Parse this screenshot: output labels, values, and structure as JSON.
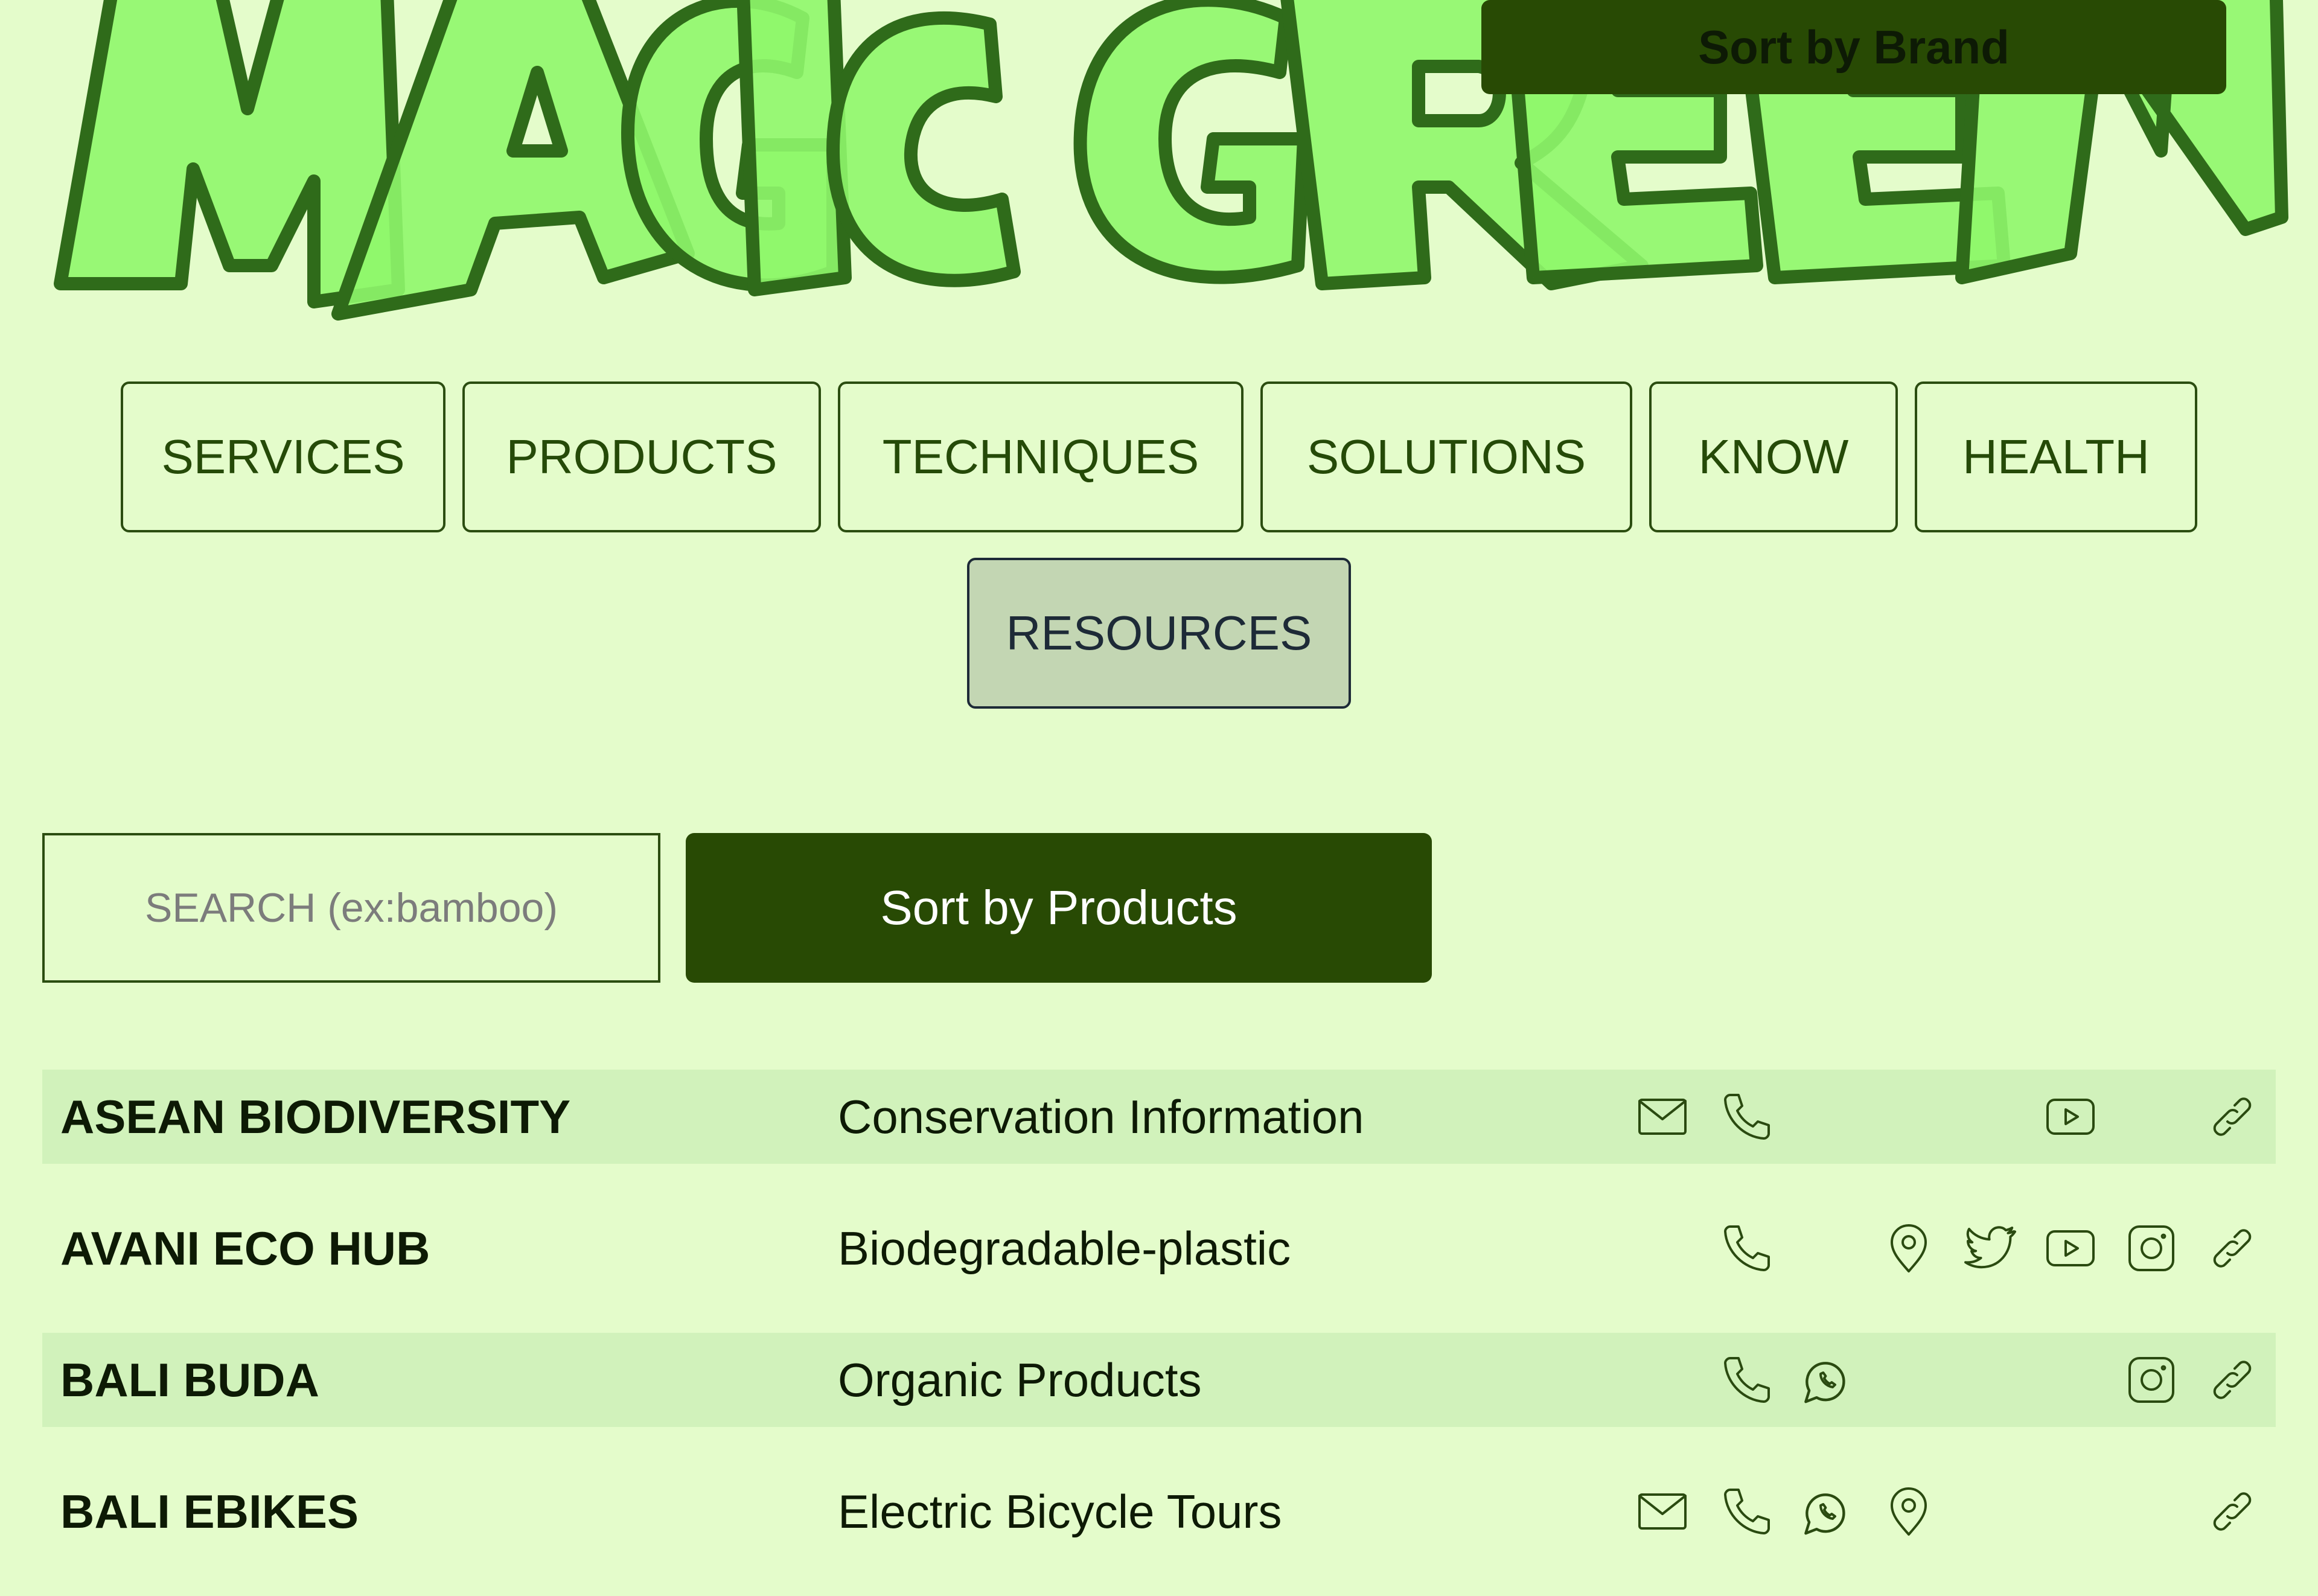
{
  "logo": {
    "text": "MAGICGREEN",
    "fill": "#8ff76b",
    "stroke": "#2f6b1a"
  },
  "nav": {
    "row1": [
      {
        "label": "SERVICES"
      },
      {
        "label": "PRODUCTS"
      },
      {
        "label": "TECHNIQUES"
      },
      {
        "label": "SOLUTIONS"
      },
      {
        "label": "KNOW"
      },
      {
        "label": "HEALTH"
      }
    ],
    "row2": [
      {
        "label": "RESOURCES",
        "active": true
      }
    ]
  },
  "search": {
    "placeholder": "SEARCH (ex:bamboo)",
    "value": ""
  },
  "sort": {
    "products_label": "Sort by Products",
    "brand_label": "Sort by Brand"
  },
  "list": [
    {
      "brand": "ASEAN BIODIVERSITY",
      "category": "Conservation Information",
      "icons": [
        "mail-icon",
        "phone-icon",
        "youtube-icon",
        "link-icon"
      ]
    },
    {
      "brand": "AVANI ECO HUB",
      "category": "Biodegradable-plastic",
      "icons": [
        "phone-icon",
        "map-pin-icon",
        "twitter-icon",
        "youtube-icon",
        "instagram-icon",
        "link-icon"
      ]
    },
    {
      "brand": "BALI BUDA",
      "category": "Organic Products",
      "icons": [
        "phone-icon",
        "whatsapp-icon",
        "instagram-icon",
        "link-icon"
      ]
    },
    {
      "brand": "BALI EBIKES",
      "category": "Electric Bicycle Tours",
      "icons": [
        "mail-icon",
        "phone-icon",
        "whatsapp-icon",
        "map-pin-icon",
        "link-icon"
      ]
    }
  ],
  "colors": {
    "background": "#e4fccb",
    "dark_green": "#284a04",
    "row_shade": "#d1f2bb",
    "active_nav": "#c3d6b3"
  }
}
